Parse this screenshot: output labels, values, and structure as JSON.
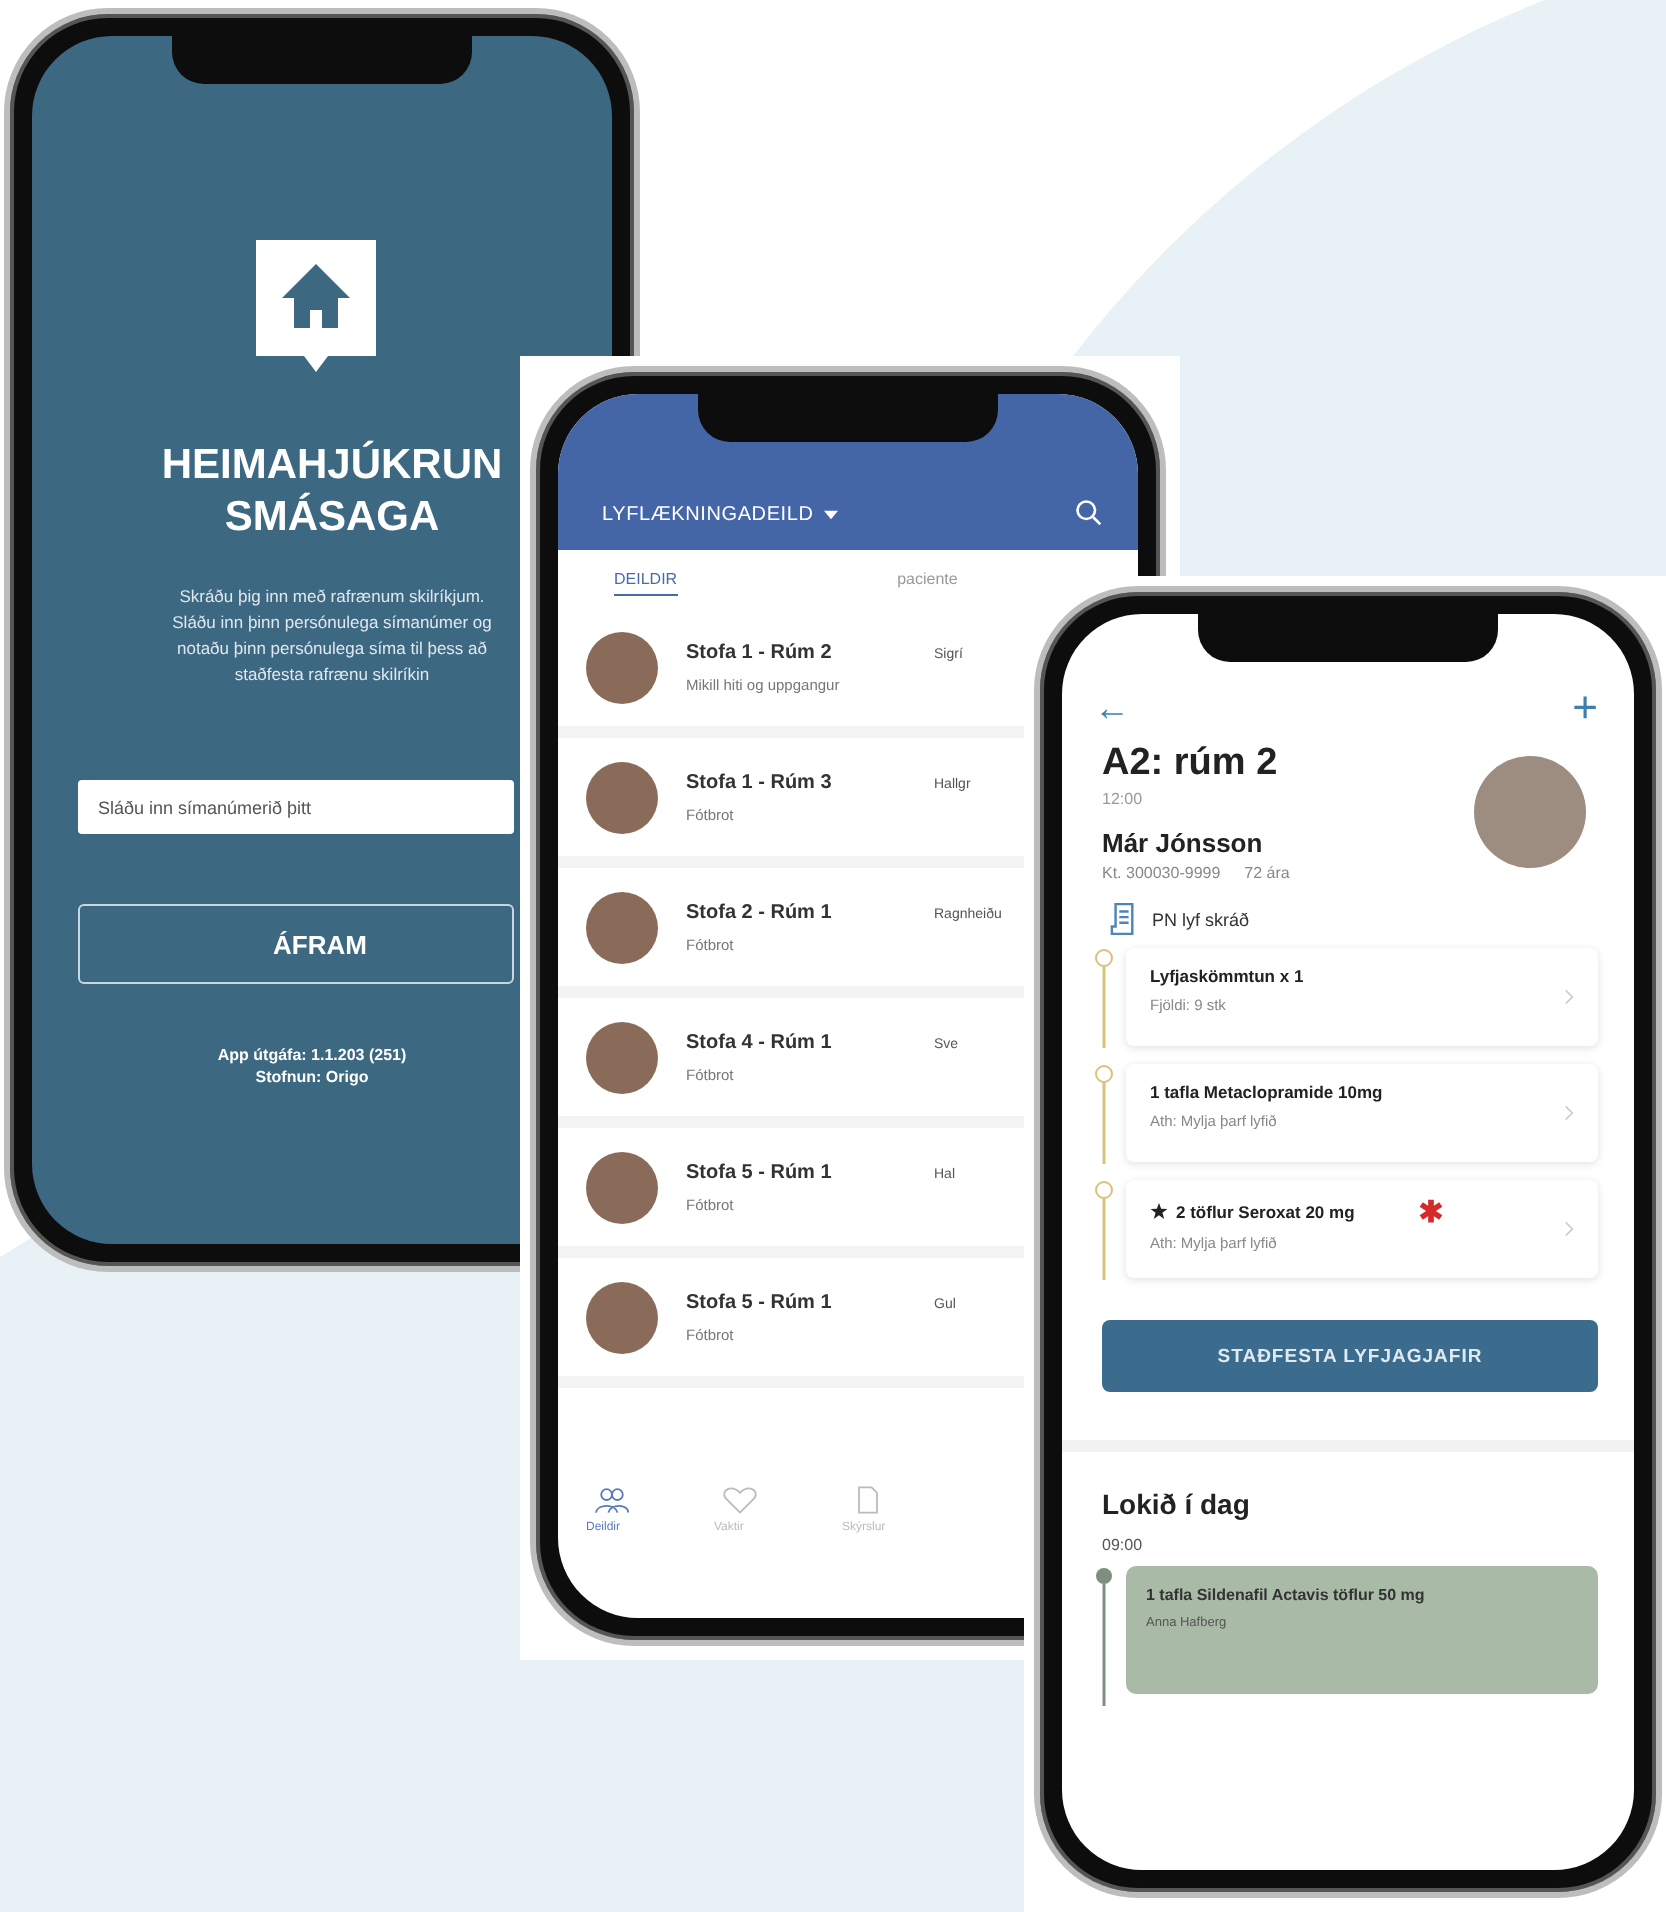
{
  "login_screen": {
    "title_lines": [
      "HEIMAHJÚKRUN",
      "SMÁSAGA"
    ],
    "instructions": "Skráðu þig inn með rafrænum skilríkjum. Sláðu inn þinn persónulega símanúmer og notaðu þinn persónulega síma til þess að staðfesta rafrænu skilríkin",
    "phone_field": {
      "placeholder": "Sláðu inn símanúmerið þitt"
    },
    "continue_button": "ÁFRAM",
    "version": "App útgáfa: 1.1.203 (251)",
    "organization": "Stofnun: Origo"
  },
  "ward_screen": {
    "ward": "LYFLÆKNINGADEILD",
    "tabs": [
      {
        "label": "DEILDIR",
        "selected": true
      },
      {
        "label": "paciente",
        "selected": false
      }
    ],
    "rooms": [
      {
        "room": "Stofa 1 - Rúm 2",
        "note": "Mikill hiti og uppgangur",
        "column_3": "Sigrí"
      },
      {
        "room": "Stofa 1 - Rúm 3",
        "note": "Fótbrot",
        "column_3": "Hallgr"
      },
      {
        "room": "Stofa 2 - Rúm 1",
        "note": "Fótbrot",
        "column_3": "Ragnheiðu"
      },
      {
        "room": "Stofa 4 - Rúm 1",
        "note": "Fótbrot",
        "column_3": "Sve"
      },
      {
        "room": "Stofa 5 - Rúm 1",
        "note": "Fótbrot",
        "column_3": "Hal"
      },
      {
        "room": "Stofa 5 - Rúm 1",
        "note": "Fótbrot",
        "column_3": "Gul"
      }
    ],
    "nav": [
      {
        "kind": "people",
        "label": "Deildir",
        "selected": true
      },
      {
        "kind": "heart",
        "label": "Vaktir",
        "selected": false
      },
      {
        "kind": "document",
        "label": "Skýrslur",
        "selected": false
      }
    ]
  },
  "patient_screen": {
    "back": "←",
    "add": "+",
    "room": "A2: rúm 2",
    "time": "12:00",
    "name": "Már Jónsson",
    "id_number": "Kt. 300030-9999",
    "age": "72 ára",
    "prn_link": "PN lyf skráð",
    "medications": [
      {
        "title": "Lyfjaskömmtun x 1",
        "detail": "Fjöldi: 9 stk",
        "starred": false,
        "alert": false
      },
      {
        "title": "1 tafla Metaclopramide 10mg",
        "detail": "Ath: Mylja þarf lyfið",
        "starred": false,
        "alert": false
      },
      {
        "title": "2 töflur Seroxat 20 mg",
        "detail": "Ath: Mylja þarf lyfið",
        "starred": true,
        "alert": true
      }
    ],
    "confirm_button": "STAÐFESTA LYFJAGJAFIR",
    "done_heading": "Lokið í dag",
    "done_time": "09:00",
    "done_items": [
      {
        "title": "1 tafla Sildenafil Actavis töflur 50 mg",
        "by": "Anna Hafberg"
      }
    ]
  }
}
